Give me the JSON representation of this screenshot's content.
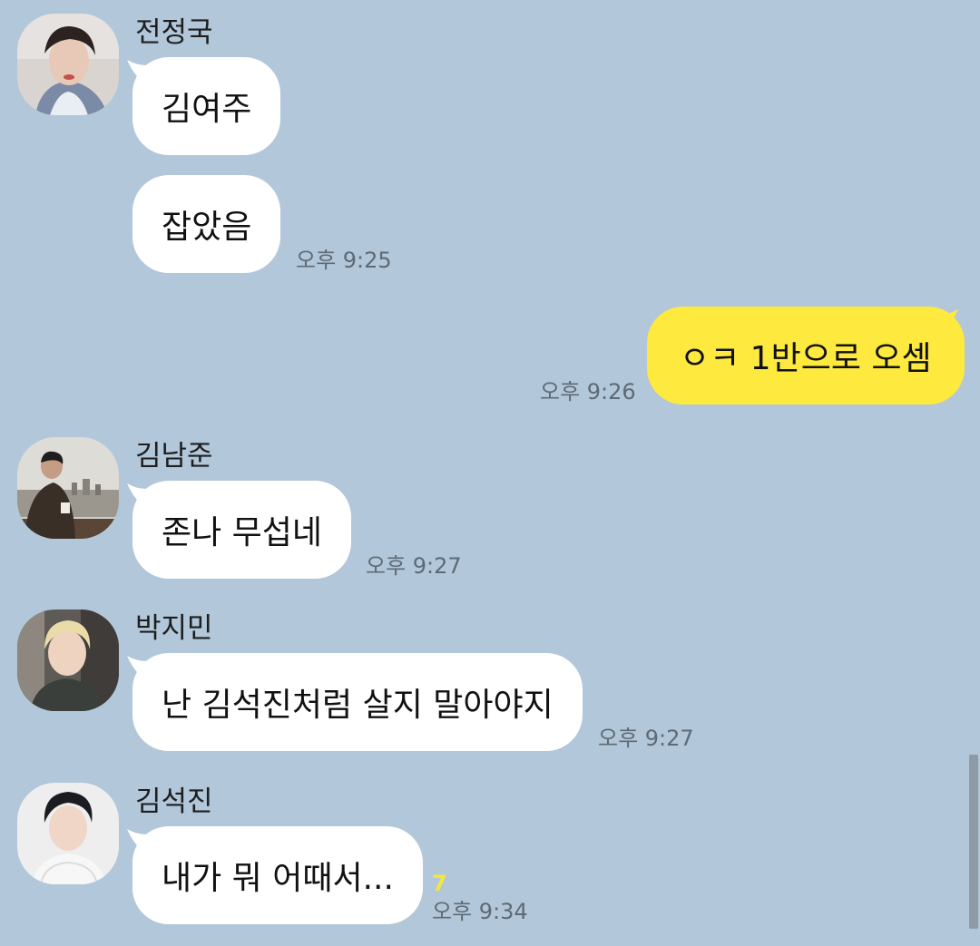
{
  "colors": {
    "background": "#b2c7da",
    "incoming_bubble": "#ffffff",
    "outgoing_bubble": "#fee93f",
    "time_text": "#5e6a75",
    "unread_count": "#f4e73c"
  },
  "messages": [
    {
      "sender": "전정국",
      "avatar": "profile-photo-icon",
      "bubbles": [
        "김여주",
        "잡았음"
      ],
      "time": "오후 9:25"
    },
    {
      "sender": "",
      "outgoing": true,
      "bubbles": [
        "ㅇㅋ 1반으로 오셈"
      ],
      "time": "오후 9:26"
    },
    {
      "sender": "김남준",
      "avatar": "profile-photo-icon",
      "bubbles": [
        "존나 무섭네"
      ],
      "time": "오후 9:27"
    },
    {
      "sender": "박지민",
      "avatar": "profile-photo-icon",
      "bubbles": [
        "난 김석진처럼 살지 말아야지"
      ],
      "time": "오후 9:27"
    },
    {
      "sender": "김석진",
      "avatar": "profile-photo-icon",
      "bubbles": [
        "내가 뭐 어때서..."
      ],
      "time": "오후 9:34",
      "unread": "7"
    }
  ]
}
